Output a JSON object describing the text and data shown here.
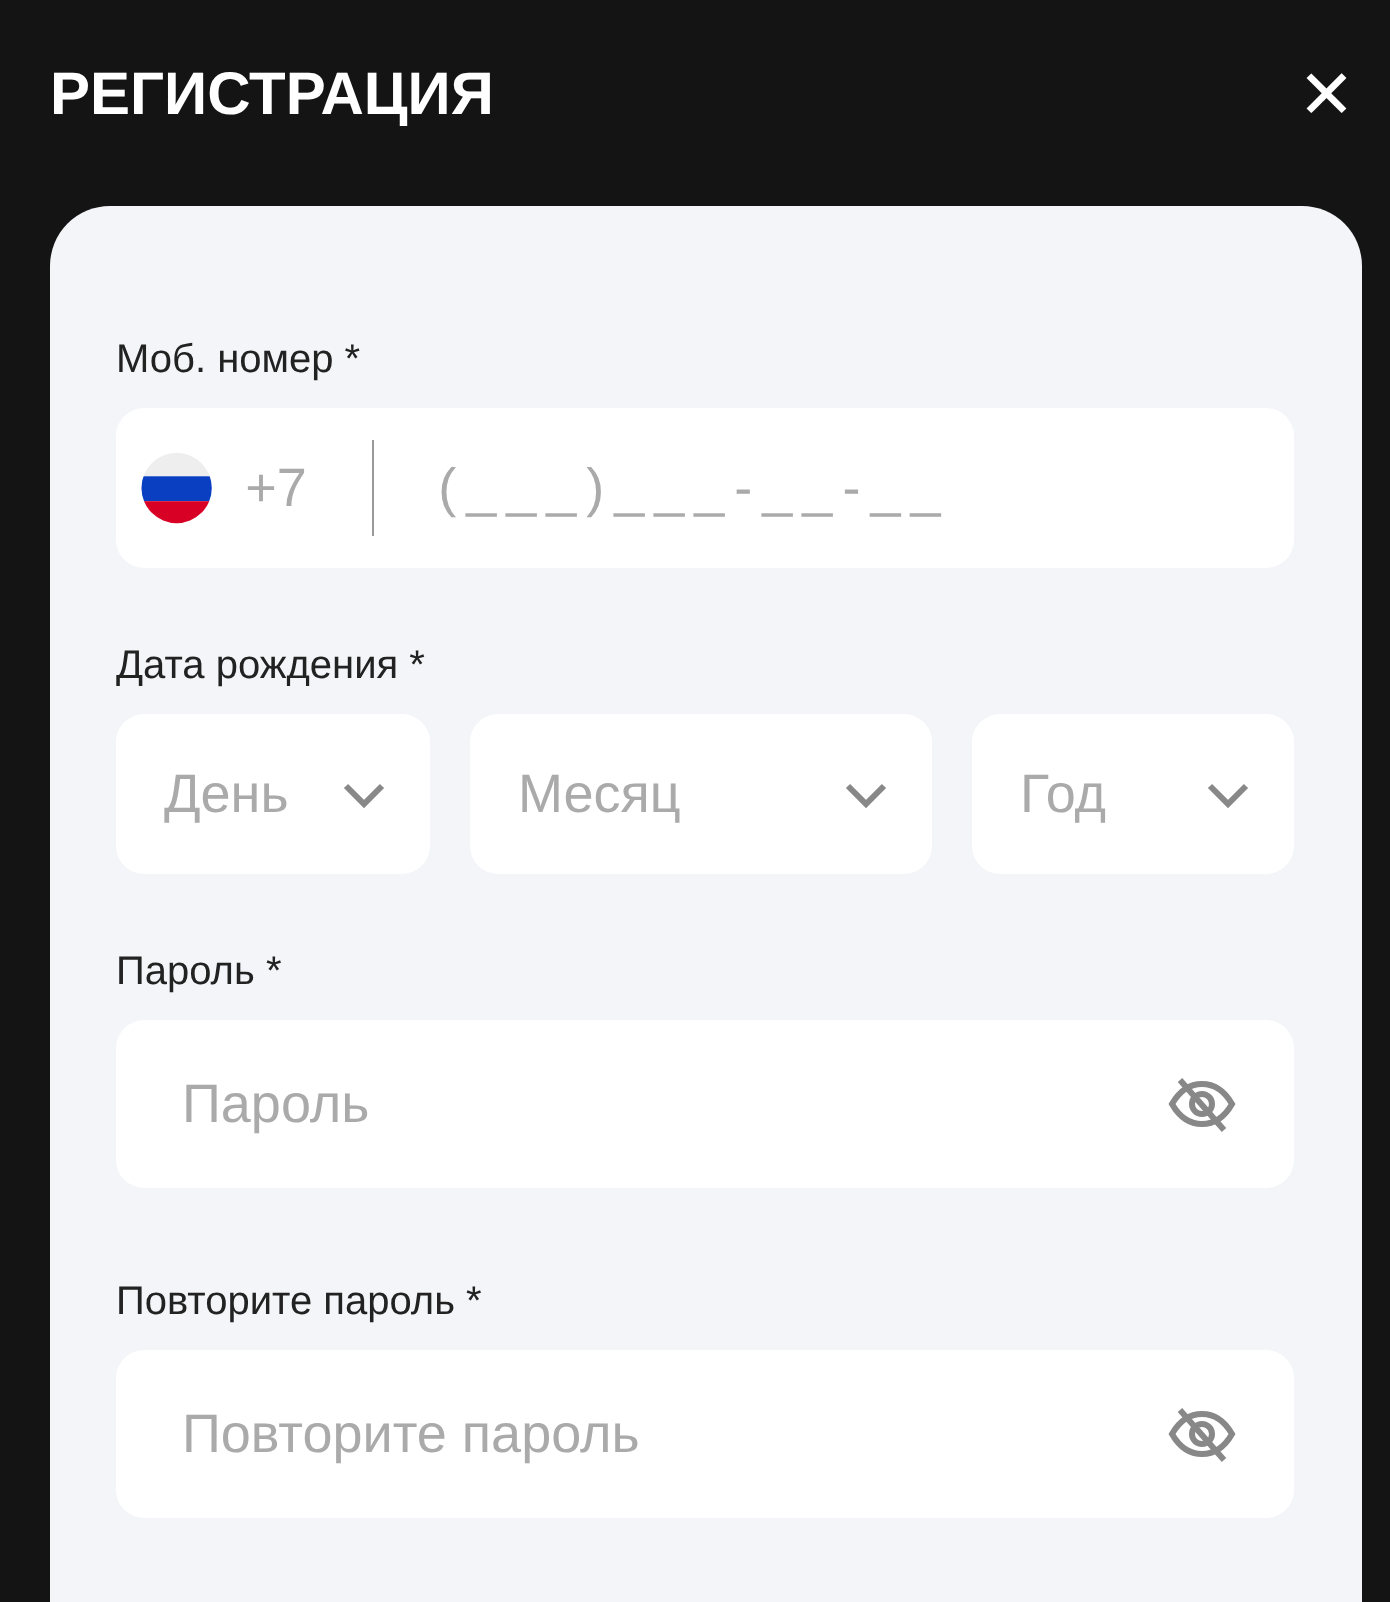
{
  "header": {
    "title": "РЕГИСТРАЦИЯ",
    "close": "✕"
  },
  "phone": {
    "label": "Моб. номер *",
    "country_code": "+7",
    "placeholder": "(___)___-__-__"
  },
  "birth_date": {
    "label": "Дата рождения *",
    "selects": [
      {
        "kind": "day",
        "placeholder": "День"
      },
      {
        "kind": "month",
        "placeholder": "Месяц"
      },
      {
        "kind": "year",
        "placeholder": "Год"
      }
    ]
  },
  "passwords": [
    {
      "label": "Пароль *",
      "placeholder": "Пароль"
    },
    {
      "label": "Повторите пароль *",
      "placeholder": "Повторите пароль"
    }
  ]
}
